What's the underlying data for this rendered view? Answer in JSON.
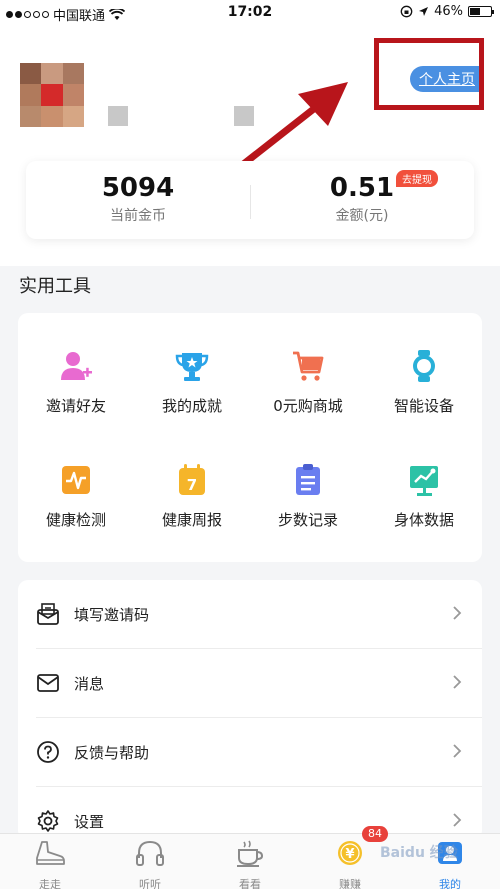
{
  "status_bar": {
    "carrier": "中国联通",
    "time": "17:02",
    "battery": "46%"
  },
  "header": {
    "profile_button": "个人主页"
  },
  "stats": {
    "coins_value": "5094",
    "coins_label": "当前金币",
    "amount_value": "0.51",
    "amount_label": "金额(元)",
    "withdraw_badge": "去提现"
  },
  "tools": {
    "title": "实用工具",
    "items": [
      {
        "label": "邀请好友",
        "icon": "invite-friend-icon"
      },
      {
        "label": "我的成就",
        "icon": "trophy-icon"
      },
      {
        "label": "0元购商城",
        "icon": "cart-icon"
      },
      {
        "label": "智能设备",
        "icon": "smartwatch-icon"
      },
      {
        "label": "健康检测",
        "icon": "heart-rate-icon"
      },
      {
        "label": "健康周报",
        "icon": "calendar-icon"
      },
      {
        "label": "步数记录",
        "icon": "clipboard-icon"
      },
      {
        "label": "身体数据",
        "icon": "body-chart-icon"
      }
    ]
  },
  "menu": {
    "items": [
      {
        "label": "填写邀请码",
        "icon": "invite-code-icon"
      },
      {
        "label": "消息",
        "icon": "mail-icon"
      },
      {
        "label": "反馈与帮助",
        "icon": "help-icon"
      },
      {
        "label": "设置",
        "icon": "gear-icon"
      }
    ]
  },
  "tab_bar": {
    "items": [
      {
        "label": "走走",
        "icon": "shoe-icon"
      },
      {
        "label": "听听",
        "icon": "headphones-icon"
      },
      {
        "label": "看看",
        "icon": "coffee-icon"
      },
      {
        "label": "赚赚",
        "icon": "coin-icon",
        "badge": "84"
      },
      {
        "label": "我的",
        "icon": "profile-icon",
        "active": true
      }
    ]
  },
  "watermark": "Baidu 经验",
  "colors": {
    "accent_blue": "#4a90e2",
    "highlight_red": "#b8151b",
    "badge_red": "#e8413b"
  }
}
